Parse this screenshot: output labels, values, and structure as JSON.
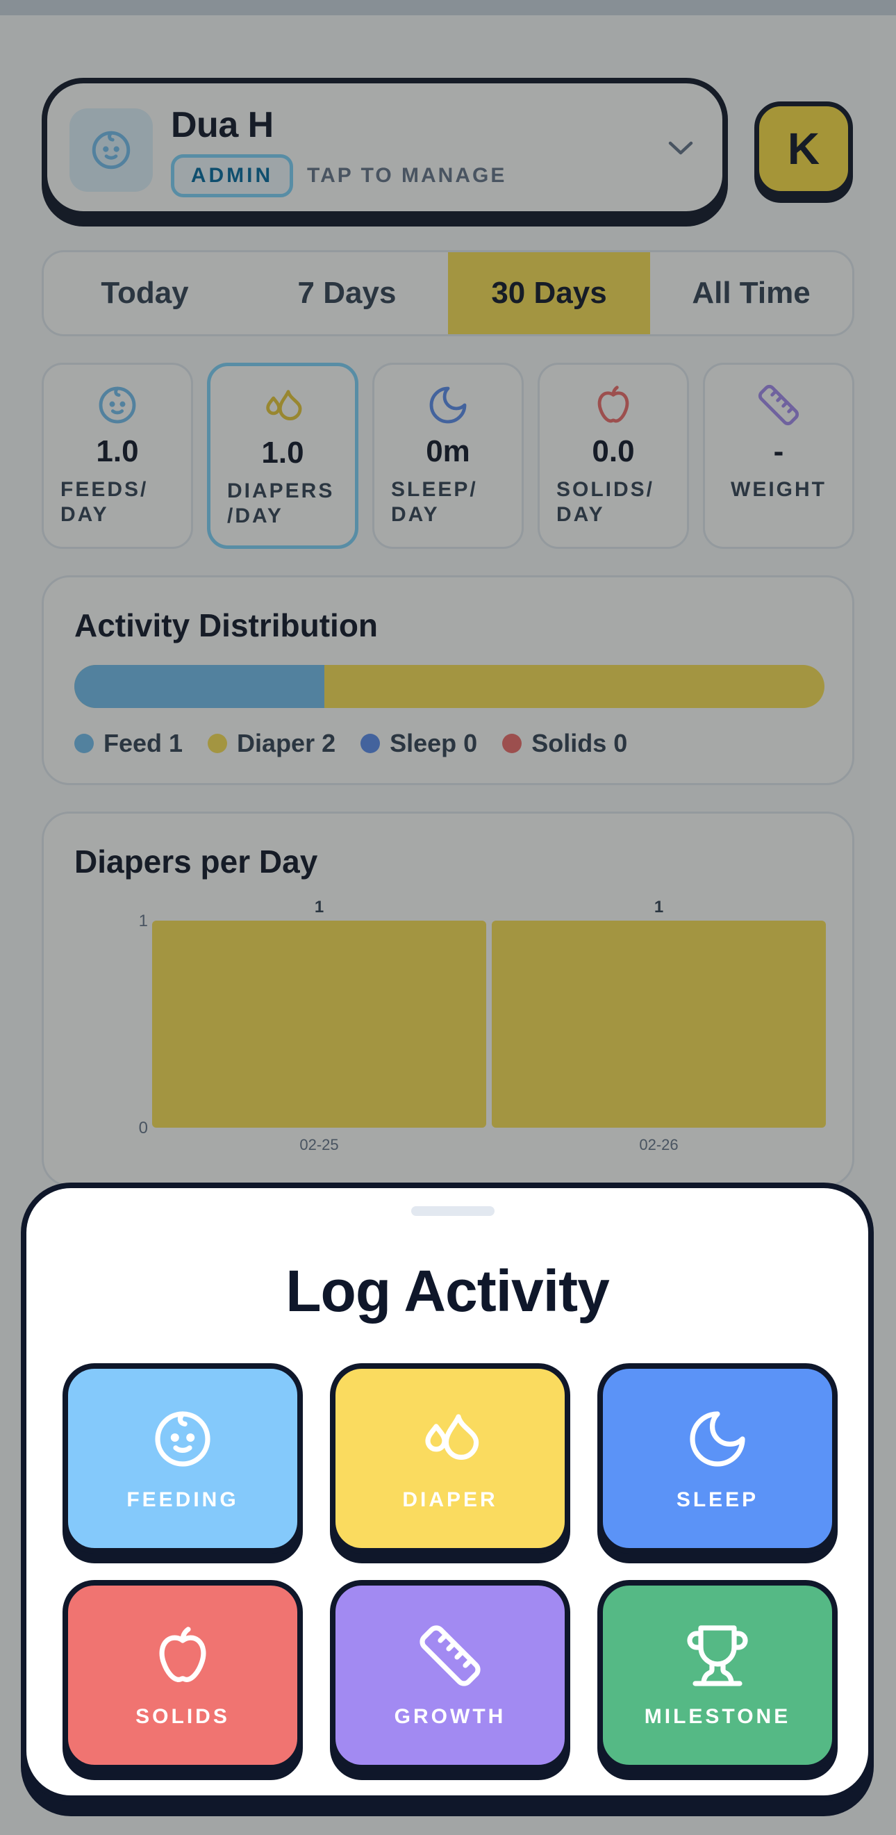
{
  "profile": {
    "name": "Dua H",
    "role_badge": "ADMIN",
    "manage_hint": "TAP TO MANAGE",
    "avatar_icon": "baby-face-icon",
    "dropdown_icon": "chevron-down-icon",
    "user_initial": "K"
  },
  "range_tabs": [
    {
      "label": "Today",
      "active": false
    },
    {
      "label": "7 Days",
      "active": false
    },
    {
      "label": "30 Days",
      "active": true
    },
    {
      "label": "All Time",
      "active": false
    }
  ],
  "stats": [
    {
      "value": "1.0",
      "label": "FEEDS/ DAY",
      "icon": "baby-face-icon",
      "color": "#74bef0"
    },
    {
      "value": "1.0",
      "label": "DIAPERS /DAY",
      "icon": "droplets-icon",
      "color": "#e8c83a",
      "selected": true
    },
    {
      "value": "0m",
      "label": "SLEEP/ DAY",
      "icon": "moon-icon",
      "color": "#5b8def"
    },
    {
      "value": "0.0",
      "label": "SOLIDS/ DAY",
      "icon": "apple-icon",
      "color": "#ef6b6b"
    },
    {
      "value": "-",
      "label": "WEIGHT",
      "icon": "ruler-icon",
      "color": "#a48af0"
    }
  ],
  "distribution": {
    "title": "Activity Distribution",
    "items": [
      {
        "label": "Feed 1",
        "count": 1,
        "color": "#74bef0"
      },
      {
        "label": "Diaper 2",
        "count": 2,
        "color": "#fbdf56"
      },
      {
        "label": "Sleep 0",
        "count": 0,
        "color": "#5b8def"
      },
      {
        "label": "Solids 0",
        "count": 0,
        "color": "#ef6b6b"
      }
    ]
  },
  "chart_data": {
    "type": "bar",
    "title": "Diapers per Day",
    "categories": [
      "02-25",
      "02-26"
    ],
    "values": [
      1,
      1
    ],
    "data_labels": [
      "1",
      "1"
    ],
    "y_ticks": [
      "0",
      "1"
    ],
    "ylim": [
      0,
      1
    ],
    "bar_color": "#fbdf56"
  },
  "sheet": {
    "title": "Log Activity",
    "actions": [
      {
        "label": "FEEDING",
        "icon": "baby-face-icon",
        "color": "#84c9fb"
      },
      {
        "label": "DIAPER",
        "icon": "droplets-icon",
        "color": "#fadb5f"
      },
      {
        "label": "SLEEP",
        "icon": "moon-icon",
        "color": "#5b93f7"
      },
      {
        "label": "SOLIDS",
        "icon": "apple-icon",
        "color": "#f07471"
      },
      {
        "label": "GROWTH",
        "icon": "ruler-icon",
        "color": "#a28af2"
      },
      {
        "label": "MILESTONE",
        "icon": "trophy-icon",
        "color": "#55b985"
      }
    ]
  }
}
